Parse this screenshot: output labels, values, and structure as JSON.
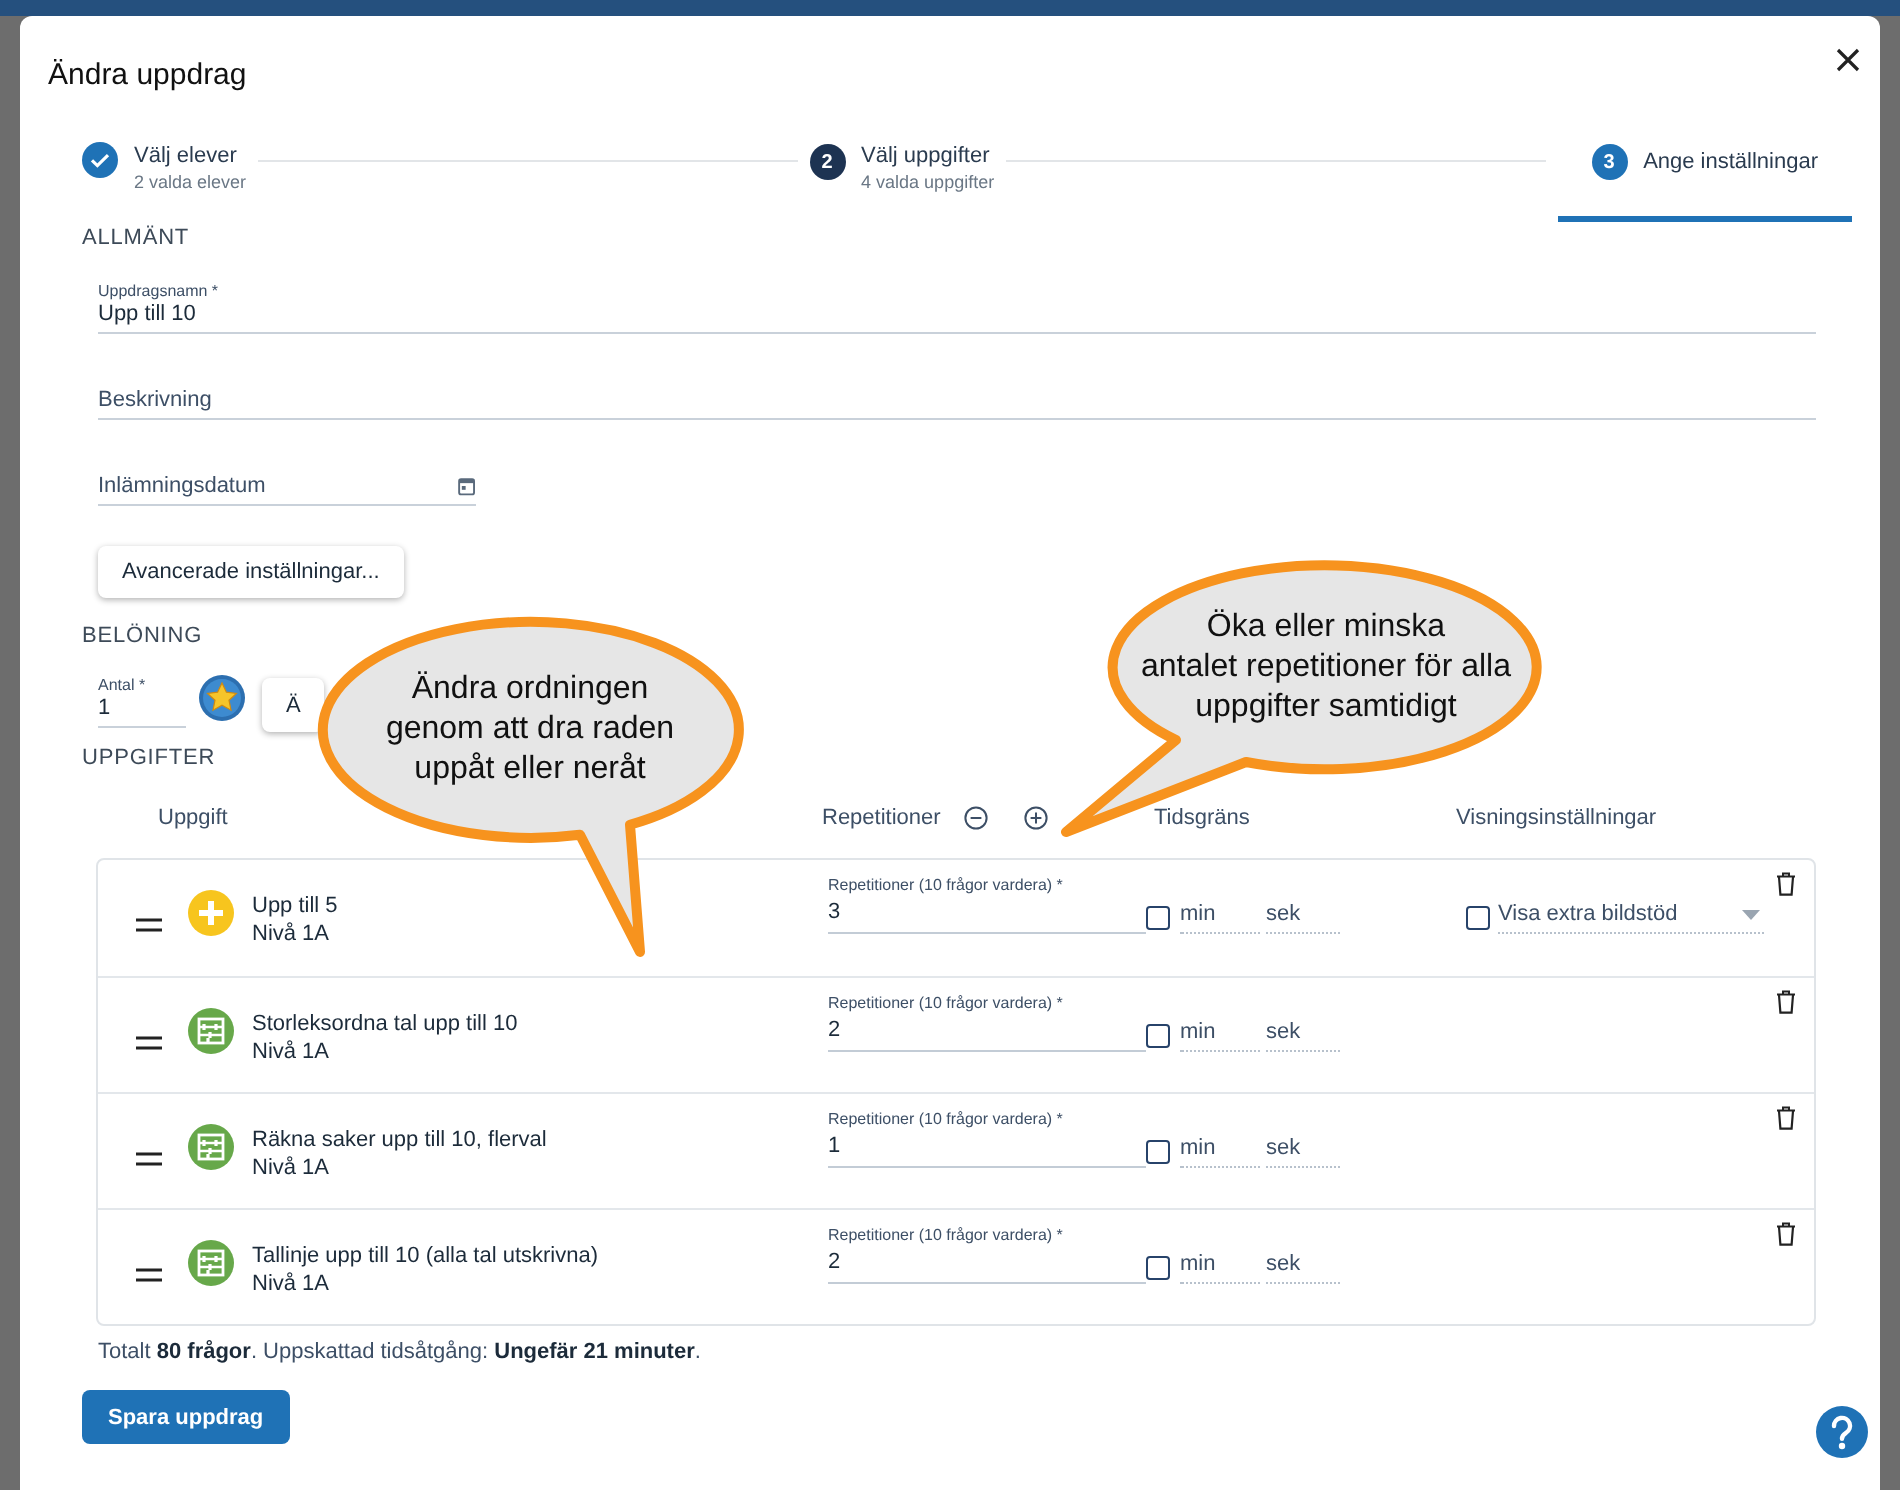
{
  "dialog": {
    "title": "Ändra uppdrag"
  },
  "steps": [
    {
      "kind": "done",
      "label": "Välj elever",
      "sublabel": "2 valda elever",
      "selected": false
    },
    {
      "kind": "numbered",
      "marker": "2",
      "label": "Välj uppgifter",
      "sublabel": "4 valda uppgifter",
      "selected": false
    },
    {
      "kind": "numbered",
      "marker": "3",
      "label": "Ange inställningar",
      "selected": true
    }
  ],
  "general": {
    "heading": "ALLMÄNT",
    "fields": [
      {
        "kind": "text",
        "label": "Uppdragsnamn *",
        "value": "Upp till 10"
      },
      {
        "kind": "text",
        "placeholder": "Beskrivning"
      },
      {
        "kind": "date",
        "placeholder": "Inlämningsdatum"
      }
    ],
    "advanced_button": "Avancerade inställningar..."
  },
  "reward": {
    "heading": "BELÖNING",
    "amount_label": "Antal *",
    "amount": "1",
    "button": "Ä"
  },
  "tasks": {
    "heading": "UPPGIFTER",
    "columns": [
      {
        "kind": "plain",
        "label": "Uppgift"
      },
      {
        "kind": "stepper",
        "label": "Repetitioner"
      },
      {
        "kind": "plain",
        "label": "Tidsgräns"
      },
      {
        "kind": "plain",
        "label": "Visningsinställningar"
      }
    ],
    "rows": [
      {
        "kind": "plus",
        "title": "Upp till 5",
        "level": "Nivå 1A",
        "rep_label": "Repetitioner (10 frågor vardera) *",
        "repetitions": "3",
        "time_limit": false,
        "min_placeholder": "min",
        "sec_placeholder": "sek",
        "display_option": {
          "label": "Visa extra bildstöd",
          "checked": false
        }
      },
      {
        "kind": "abacus",
        "title": "Storleksordna tal upp till 10",
        "level": "Nivå 1A",
        "rep_label": "Repetitioner (10 frågor vardera) *",
        "repetitions": "2",
        "time_limit": false,
        "min_placeholder": "min",
        "sec_placeholder": "sek"
      },
      {
        "kind": "abacus",
        "title": "Räkna saker upp till 10, flerval",
        "level": "Nivå 1A",
        "rep_label": "Repetitioner (10 frågor vardera) *",
        "repetitions": "1",
        "time_limit": false,
        "min_placeholder": "min",
        "sec_placeholder": "sek"
      },
      {
        "kind": "abacus",
        "title": "Tallinje upp till 10 (alla tal utskrivna)",
        "level": "Nivå 1A",
        "rep_label": "Repetitioner (10 frågor vardera) *",
        "repetitions": "2",
        "time_limit": false,
        "min_placeholder": "min",
        "sec_placeholder": "sek"
      }
    ]
  },
  "summary": "Totalt **80 frågor**. Uppskattad tidsåtgång: **Ungefär 21 minuter**.",
  "save_button": "Spara uppdrag",
  "callouts": [
    {
      "kind": "tail-down",
      "text": "Ändra ordningen\ngenom att dra raden\nuppåt eller neråt"
    },
    {
      "kind": "tail-left",
      "text": "Öka eller minska\nantalet repetitioner för alla\nuppgifter samtidigt"
    }
  ]
}
